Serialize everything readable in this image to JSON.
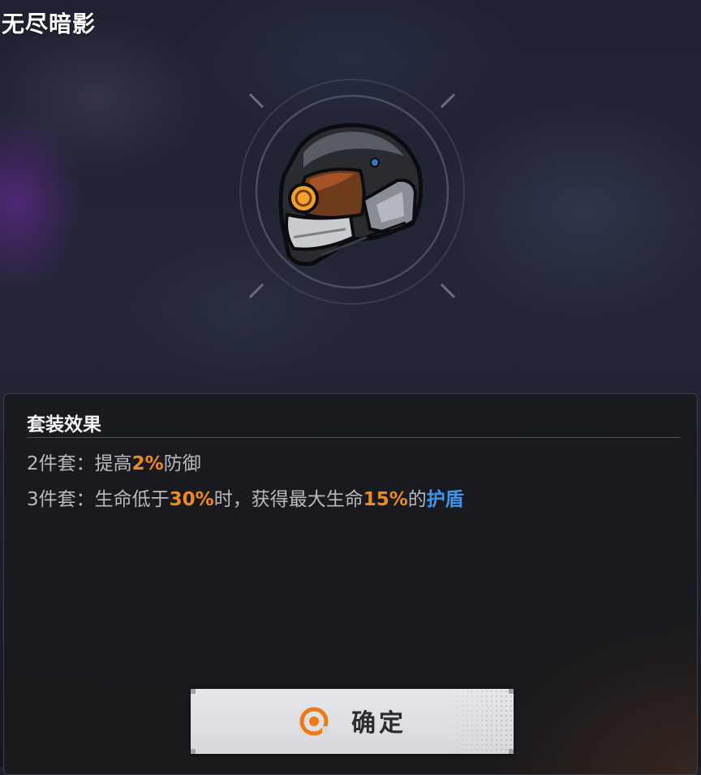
{
  "set": {
    "name": "无尽暗影",
    "item_icon": "tactical-helmet-icon"
  },
  "panel": {
    "title": "套装效果",
    "effects": [
      {
        "prefix": "2件套：",
        "parts": [
          "提高",
          "2%",
          "防御"
        ]
      },
      {
        "prefix": "3件套：",
        "parts": [
          "生命低于",
          "30%",
          "时，获得最大生命",
          "15%",
          "的",
          "护盾"
        ]
      }
    ]
  },
  "confirm_button": {
    "label": "确定",
    "icon": "target-ring-icon"
  },
  "colors": {
    "highlight_value": "#f08a1e",
    "highlight_keyword": "#3e95f2",
    "button_icon": "#f07a12"
  }
}
